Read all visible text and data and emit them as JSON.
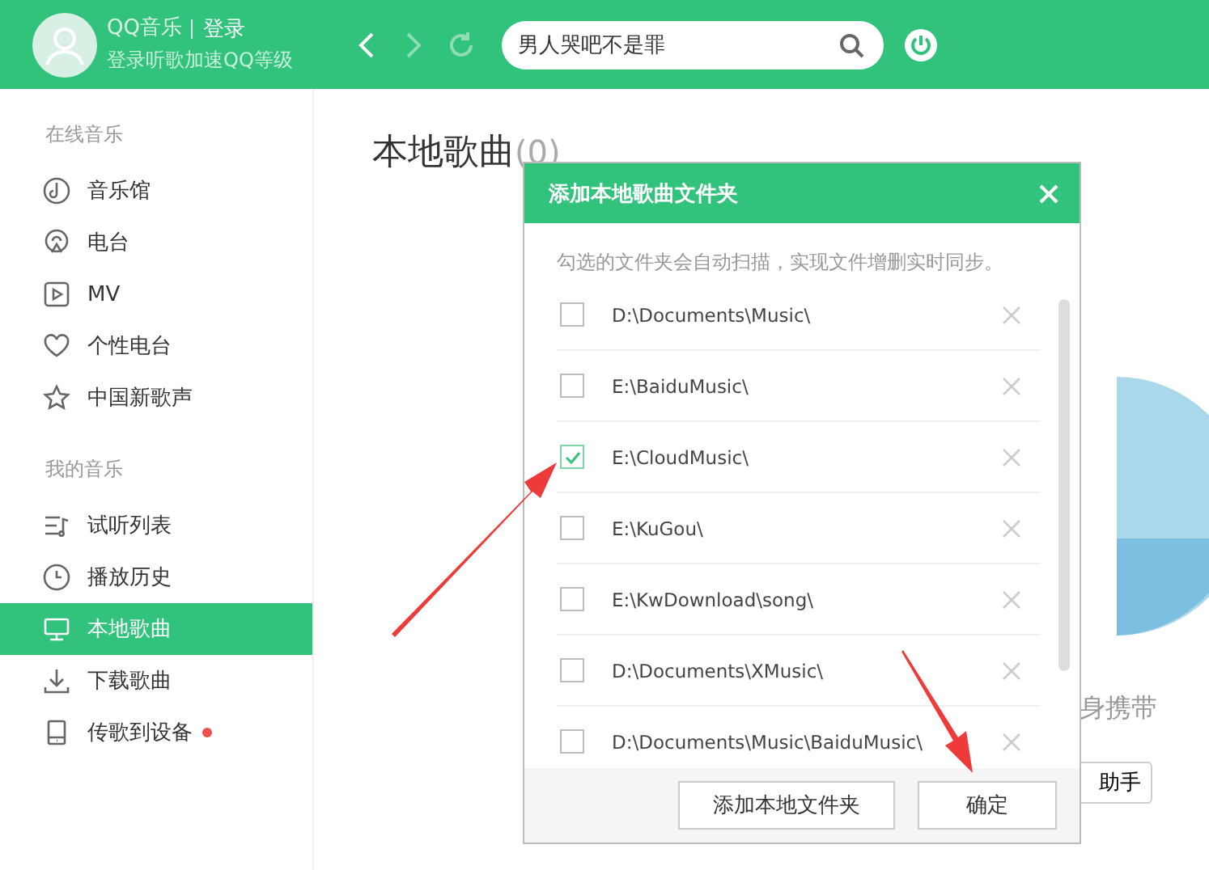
{
  "header": {
    "app_name": "QQ音乐",
    "login_link": "登录",
    "subtitle": "登录听歌加速QQ等级",
    "search": {
      "value": "男人哭吧不是罪"
    }
  },
  "sidebar": {
    "sections": [
      {
        "title": "在线音乐",
        "items": [
          {
            "label": "音乐馆",
            "selected": false
          },
          {
            "label": "电台",
            "selected": false
          },
          {
            "label": "MV",
            "selected": false
          },
          {
            "label": "个性电台",
            "selected": false
          },
          {
            "label": "中国新歌声",
            "selected": false
          }
        ]
      },
      {
        "title": "我的音乐",
        "items": [
          {
            "label": "试听列表",
            "selected": false
          },
          {
            "label": "播放历史",
            "selected": false
          },
          {
            "label": "本地歌曲",
            "selected": true
          },
          {
            "label": "下载歌曲",
            "selected": false
          },
          {
            "label": "传歌到设备",
            "selected": false,
            "notification": true
          }
        ]
      }
    ]
  },
  "page": {
    "title": "本地歌曲",
    "count": "(0)",
    "caption": "身携带",
    "button": "助手"
  },
  "dialog": {
    "title": "添加本地歌曲文件夹",
    "hint": "勾选的文件夹会自动扫描，实现文件增删实时同步。",
    "folders": [
      {
        "path": "D:\\Documents\\Music\\",
        "checked": false
      },
      {
        "path": "E:\\BaiduMusic\\",
        "checked": false
      },
      {
        "path": "E:\\CloudMusic\\",
        "checked": true
      },
      {
        "path": "E:\\KuGou\\",
        "checked": false
      },
      {
        "path": "E:\\KwDownload\\song\\",
        "checked": false
      },
      {
        "path": "D:\\Documents\\XMusic\\",
        "checked": false
      },
      {
        "path": "D:\\Documents\\Music\\BaiduMusic\\",
        "checked": false
      }
    ],
    "buttons": [
      "添加本地文件夹",
      "确定"
    ]
  }
}
